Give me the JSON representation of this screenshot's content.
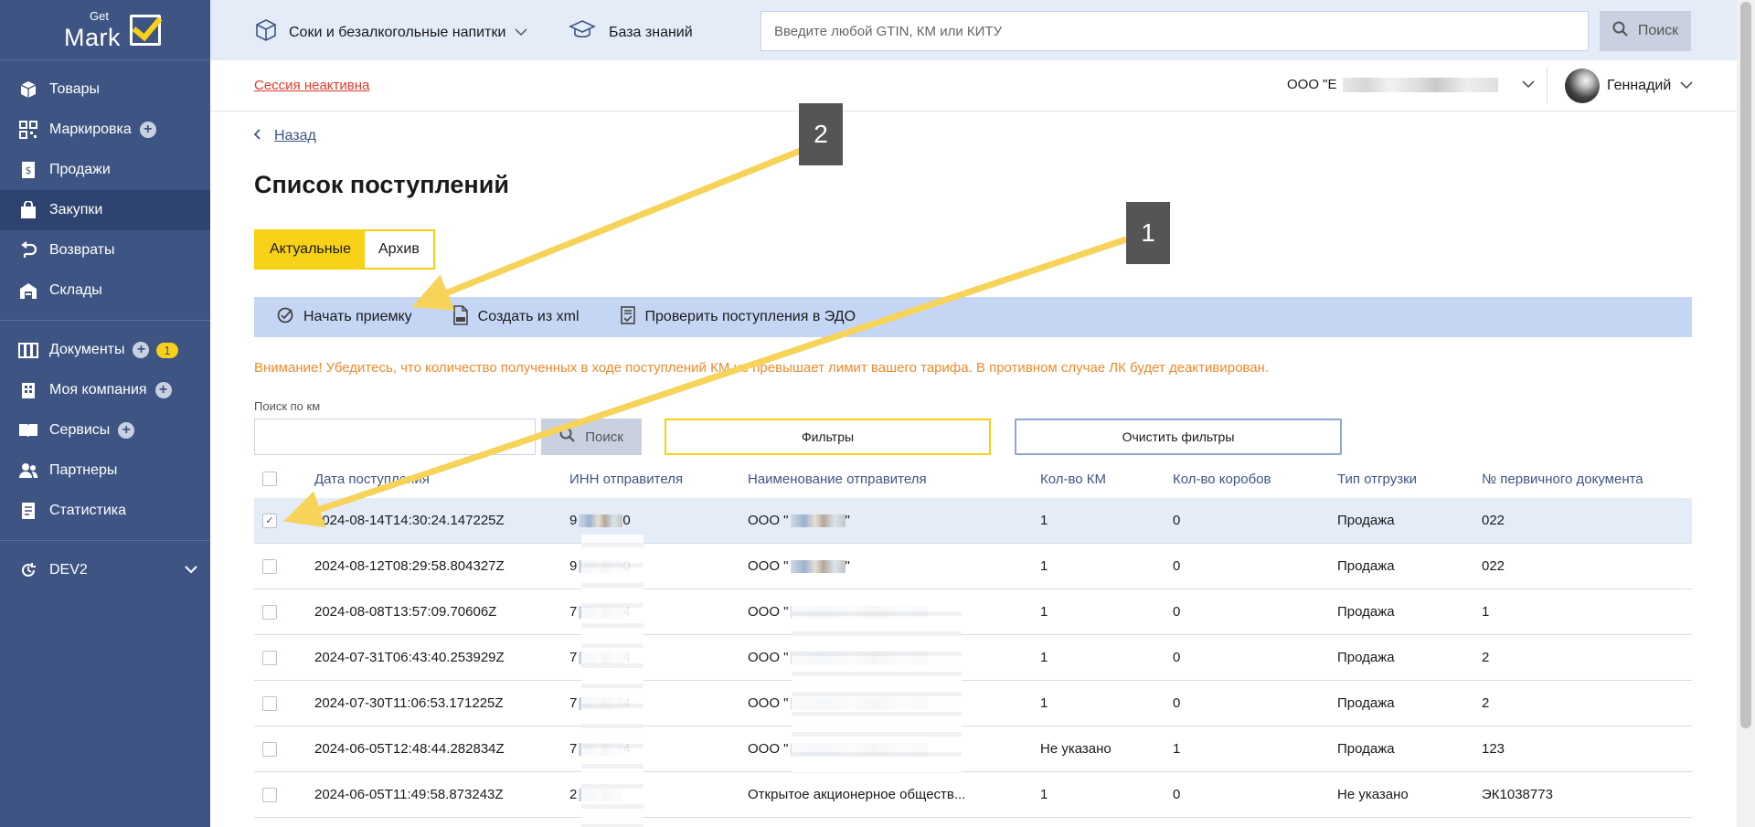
{
  "sidebar": {
    "logo": {
      "get": "Get",
      "mark": "Mark"
    },
    "groups": [
      [
        {
          "label": "Товары",
          "icon": "box-icon",
          "plus": false
        },
        {
          "label": "Маркировка",
          "icon": "qr-code-icon",
          "plus": true
        },
        {
          "label": "Продажи",
          "icon": "receipt-icon",
          "plus": false
        },
        {
          "label": "Закупки",
          "icon": "shopping-bag-icon",
          "plus": false,
          "active": true
        },
        {
          "label": "Возвраты",
          "icon": "return-arrow-icon",
          "plus": false
        },
        {
          "label": "Склады",
          "icon": "warehouse-icon",
          "plus": false
        }
      ],
      [
        {
          "label": "Документы",
          "icon": "documents-icon",
          "plus": true,
          "badge": "1"
        },
        {
          "label": "Моя компания",
          "icon": "building-icon",
          "plus": true
        },
        {
          "label": "Сервисы",
          "icon": "book-icon",
          "plus": true
        },
        {
          "label": "Партнеры",
          "icon": "people-icon",
          "plus": false
        },
        {
          "label": "Статистика",
          "icon": "stats-doc-icon",
          "plus": false
        }
      ]
    ],
    "dev": {
      "label": "DEV2",
      "icon": "refresh-icon"
    }
  },
  "topbar": {
    "category": "Соки и безалкогольные напитки",
    "knowledge": "База знаний",
    "search_placeholder": "Введите любой GTIN, КМ или КИТУ",
    "search_button": "Поиск"
  },
  "subbar": {
    "session": "Сессия неактивна",
    "org": "ООО \"Е",
    "user": "Геннадий"
  },
  "page": {
    "back": "Назад",
    "title": "Список поступлений",
    "tabs": [
      "Актуальные",
      "Архив"
    ],
    "actions": [
      "Начать приемку",
      "Создать из xml",
      "Проверить поступления в ЭДО"
    ],
    "warning": "Внимание! Убедитесь, что количество полученных в ходе поступлений КМ не превышает лимит вашего тарифа. В противном случае ЛК будет деактивирован.",
    "km_label": "Поиск по км",
    "km_search_button": "Поиск",
    "filters_button": "Фильтры",
    "clear_filters_button": "Очистить фильтры"
  },
  "table": {
    "headers": [
      "Дата поступления",
      "ИНН отправителя",
      "Наименование отправителя",
      "Кол-во КМ",
      "Кол-во коробов",
      "Тип отгрузки",
      "№ первичного документа"
    ],
    "rows": [
      {
        "date": "2024-08-14T14:30:24.147225Z",
        "inn": "9",
        "inn_end": "0",
        "name": "ООО \"",
        "name_end": "\"",
        "km": "1",
        "boxes": "0",
        "type": "Продажа",
        "doc": "022",
        "checked": true
      },
      {
        "date": "2024-08-12T08:29:58.804327Z",
        "inn": "9",
        "inn_end": "0",
        "name": "ООО \"",
        "name_end": "\"",
        "km": "1",
        "boxes": "0",
        "type": "Продажа",
        "doc": "022",
        "checked": false
      },
      {
        "date": "2024-08-08T13:57:09.70606Z",
        "inn": "7",
        "inn_end": "4",
        "name": "ООО \"",
        "name_end": "",
        "km": "1",
        "boxes": "0",
        "type": "Продажа",
        "doc": "1",
        "checked": false
      },
      {
        "date": "2024-07-31T06:43:40.253929Z",
        "inn": "7",
        "inn_end": "4",
        "name": "ООО \"",
        "name_end": "",
        "km": "1",
        "boxes": "0",
        "type": "Продажа",
        "doc": "2",
        "checked": false
      },
      {
        "date": "2024-07-30T11:06:53.171225Z",
        "inn": "7",
        "inn_end": "4",
        "name": "ООО \"",
        "name_end": "",
        "km": "1",
        "boxes": "0",
        "type": "Продажа",
        "doc": "2",
        "checked": false
      },
      {
        "date": "2024-06-05T12:48:44.282834Z",
        "inn": "7",
        "inn_end": "4",
        "name": "ООО \"",
        "name_end": "",
        "km": "Не указано",
        "boxes": "1",
        "type": "Продажа",
        "doc": "123",
        "checked": false
      },
      {
        "date": "2024-06-05T11:49:58.873243Z",
        "inn": "2",
        "inn_end": "",
        "name": "Открытое акционерное обществ...",
        "name_end": "",
        "km": "1",
        "boxes": "0",
        "type": "Не указано",
        "doc": "ЭК1038773",
        "checked": false
      }
    ]
  },
  "annotations": {
    "marker1": "1",
    "marker2": "2",
    "arrow_color": "#f7d35a"
  },
  "colors": {
    "sidebar": "#3e5584",
    "accent": "#f7d117",
    "warning": "#ee8a2c",
    "session": "#e03b2b"
  }
}
